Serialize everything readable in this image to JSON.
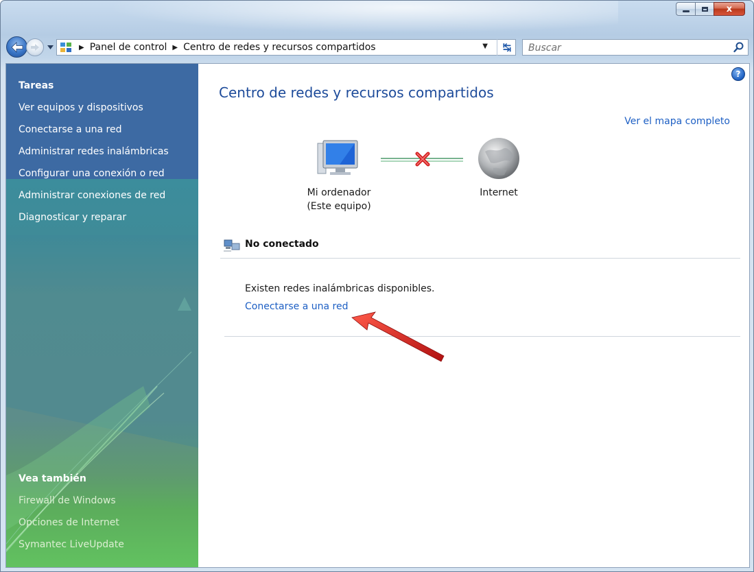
{
  "window": {
    "colors": {
      "frame": "#c2d6ea",
      "sidebar_top": "#3d6aa3",
      "sidebar_bottom": "#62c260",
      "link": "#1d5fc4",
      "title": "#1d4b9a",
      "close": "#c2412a",
      "arrow": "#d11c1c"
    }
  },
  "caption_buttons": {
    "minimize_icon": "minimize-icon",
    "maximize_icon": "maximize-icon",
    "close_icon": "close-icon",
    "close_glyph": "x"
  },
  "address": {
    "crumbs": [
      "Panel de control",
      "Centro de redes y recursos compartidos"
    ]
  },
  "search": {
    "placeholder": "Buscar"
  },
  "sidebar": {
    "tasks_heading": "Tareas",
    "tasks": [
      "Ver equipos y dispositivos",
      "Conectarse a una red",
      "Administrar redes inalámbricas",
      "Configurar una conexión o red",
      "Administrar conexiones de red",
      "Diagnosticar y reparar"
    ],
    "see_also_heading": "Vea también",
    "see_also": [
      "Firewall de Windows",
      "Opciones de Internet",
      "Symantec LiveUpdate"
    ]
  },
  "main": {
    "title": "Centro de redes y recursos compartidos",
    "full_map_link": "Ver el mapa completo",
    "computer_label_1": "Mi ordenador",
    "computer_label_2": "(Este equipo)",
    "internet_label": "Internet",
    "status": "No conectado",
    "available_text": "Existen redes inalámbricas disponibles.",
    "connect_link": "Conectarse a una red"
  }
}
